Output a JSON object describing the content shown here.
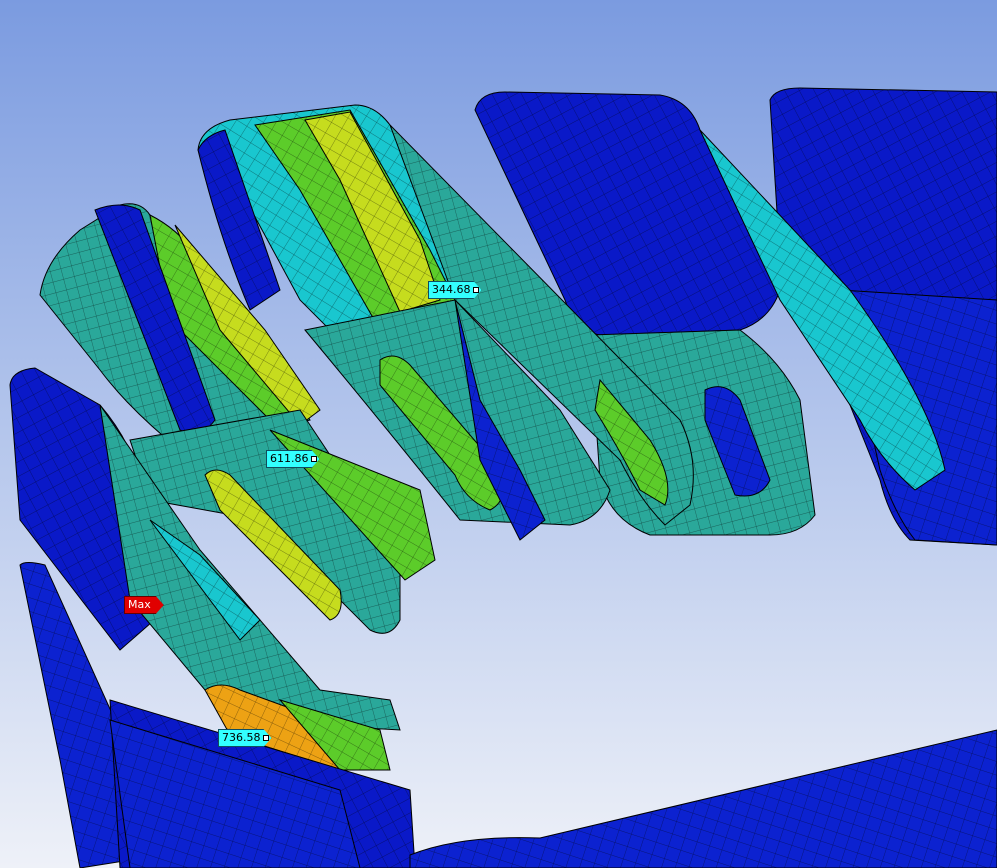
{
  "viewport": {
    "background_top": "#7b9be0",
    "background_bottom": "#eef1f8"
  },
  "colors": {
    "mesh_blue": "#0a19c8",
    "mesh_cyan": "#16c7d6",
    "mesh_teal": "#26b5a8",
    "mesh_green": "#58d22a",
    "mesh_yellow": "#c8e21a",
    "mesh_orange": "#f0a010",
    "mesh_line": "#000000",
    "probe_fill": "#33ffff",
    "max_fill": "#e00000"
  },
  "probes": [
    {
      "value": "344.68"
    },
    {
      "value": "611.86"
    },
    {
      "value": "736.58"
    }
  ],
  "max_marker": {
    "label": "Max"
  }
}
